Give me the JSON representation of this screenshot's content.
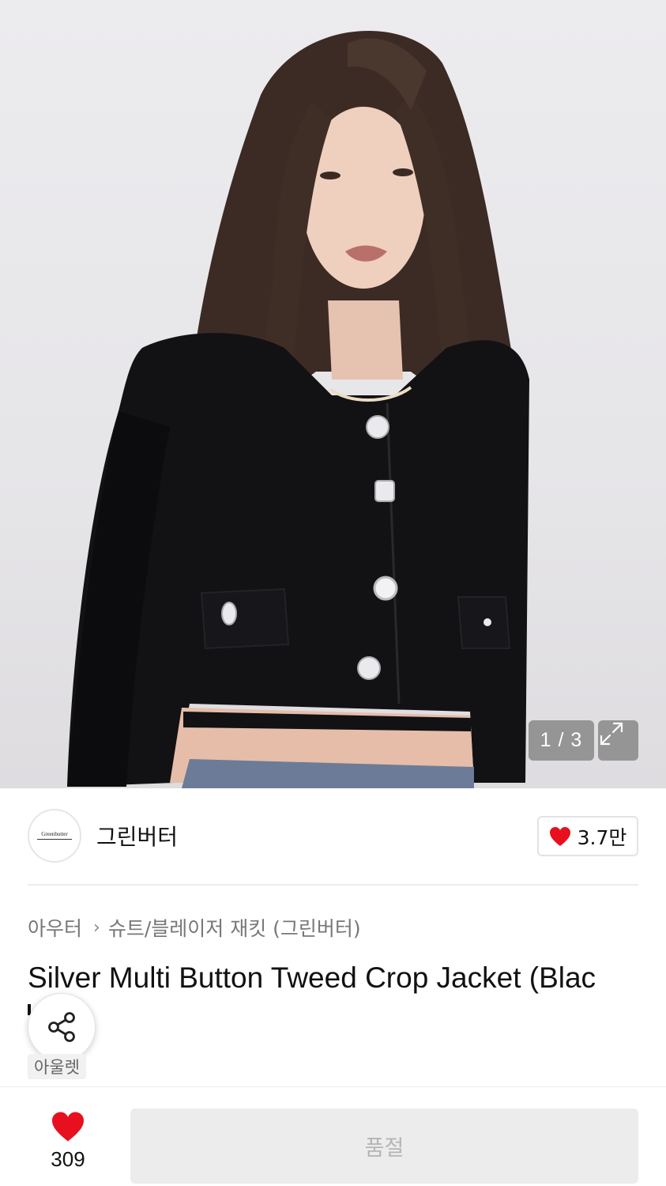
{
  "gallery": {
    "counter": "1 / 3",
    "expand_icon": "expand-icon"
  },
  "brand": {
    "name": "그린버터",
    "logo_text": "Greenbutter",
    "likes": "3.7만"
  },
  "product": {
    "breadcrumb": [
      "아우터",
      "슈트/블레이저 재킷 (그린버터)"
    ],
    "title": "Silver Multi Button Tweed Crop Jacket (Blac",
    "tag": "아울렛"
  },
  "bottom_bar": {
    "wish_count": "309",
    "soldout_label": "품절"
  },
  "colors": {
    "accent_red": "#e8101e",
    "soldout_bg": "#ececec"
  }
}
